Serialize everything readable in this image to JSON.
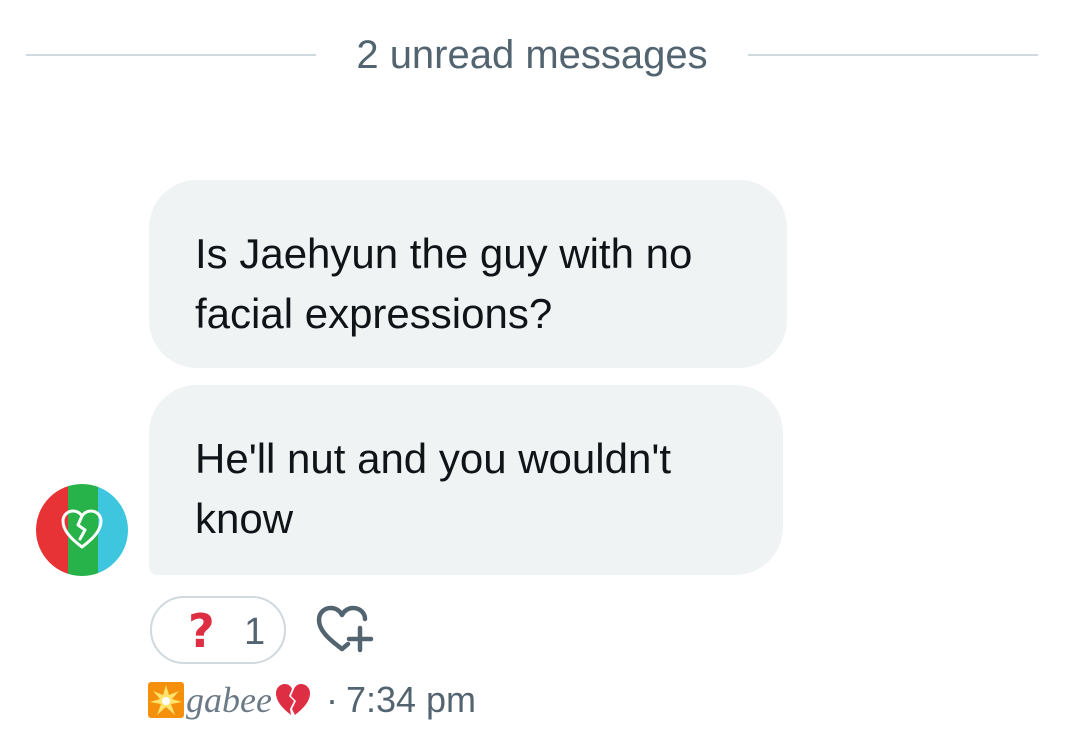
{
  "divider": {
    "label": "2 unread messages"
  },
  "messages": [
    {
      "lines": [
        "Is Jaehyun the guy with no",
        "facial expressions?"
      ]
    },
    {
      "lines": [
        "He'll nut and you wouldn't",
        "know"
      ]
    }
  ],
  "avatar": {
    "icon": "broken-heart-icon",
    "colors": [
      "#e73236",
      "#27b34a",
      "#3ec6df"
    ]
  },
  "reaction": {
    "emoji": "?",
    "count": "1",
    "color": "#dd2e44"
  },
  "add_reaction": {
    "icon": "add-reaction-heart-icon"
  },
  "meta": {
    "sender_prefix_icon": "sparkle-star-icon",
    "sender_name": "gabee",
    "sender_suffix_icon": "broken-heart-icon",
    "separator": "·",
    "time": "7:34 pm"
  },
  "colors": {
    "bubble": "#eff3f4",
    "divider_line": "#cfd9de",
    "secondary_text": "#536471"
  }
}
